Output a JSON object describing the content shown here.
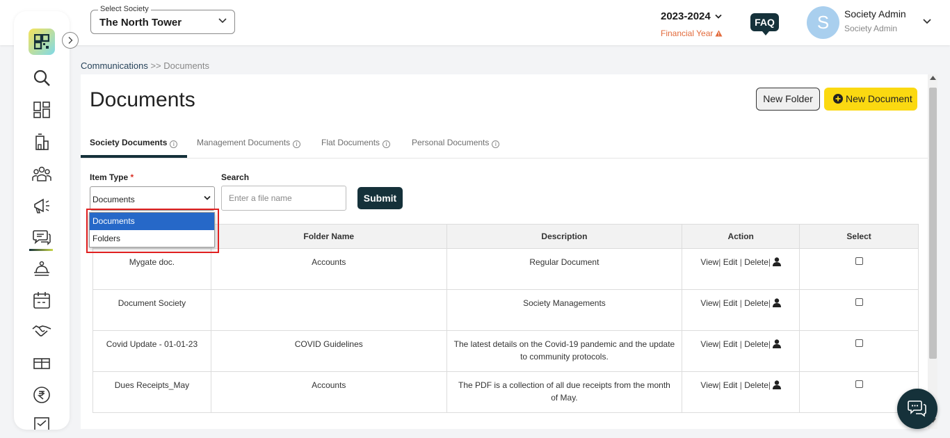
{
  "header": {
    "society_label": "Select Society",
    "society_value": "The North Tower",
    "financial_year": "2023-2024",
    "financial_year_label": "Financial Year",
    "faq_label": "FAQ",
    "avatar_initial": "S",
    "user_name": "Society Admin",
    "user_role": "Society Admin"
  },
  "sidebar": {
    "items": [
      "search-icon",
      "dashboard-icon",
      "building-icon",
      "community-icon",
      "announcement-icon",
      "communications-icon",
      "helpdesk-icon",
      "calendar-icon",
      "handshake-icon",
      "amenities-icon",
      "payments-icon",
      "reports-icon"
    ]
  },
  "breadcrumb": {
    "parent": "Communications",
    "separator": ">>",
    "current": "Documents"
  },
  "page": {
    "title": "Documents",
    "new_folder": "New Folder",
    "new_document": "New Document"
  },
  "tabs": [
    {
      "label": "Society Documents",
      "active": true
    },
    {
      "label": "Management Documents",
      "active": false
    },
    {
      "label": "Flat Documents",
      "active": false
    },
    {
      "label": "Personal Documents",
      "active": false
    }
  ],
  "filters": {
    "item_type_label": "Item Type",
    "required_mark": "*",
    "item_type_value": "Documents",
    "search_label": "Search",
    "search_placeholder": "Enter a file name",
    "submit_label": "Submit"
  },
  "dropdown": {
    "options": [
      {
        "label": "Documents",
        "selected": true
      },
      {
        "label": "Folders",
        "selected": false
      }
    ]
  },
  "table": {
    "columns": [
      "",
      "Folder Name",
      "Description",
      "Action",
      "Select"
    ],
    "action_labels": {
      "view": "View",
      "edit": "Edit",
      "delete": "Delete",
      "sep": "|"
    },
    "rows": [
      {
        "name": "Mygate doc.",
        "folder": "Accounts",
        "description": "Regular Document"
      },
      {
        "name": "Document Society",
        "folder": "",
        "description": "Society Managements"
      },
      {
        "name": "Covid Update - 01-01-23",
        "folder": "COVID Guidelines",
        "description": "The latest details on the Covid-19 pandemic and the update to community protocols."
      },
      {
        "name": "Dues Receipts_May",
        "folder": "Accounts",
        "description": "The PDF is a collection of all due receipts from the month of May."
      }
    ]
  },
  "colors": {
    "primary": "#15313a",
    "accent_yellow": "#fbd911",
    "warning": "#e26a3b",
    "link": "#2563a8",
    "highlight": "#e02020"
  }
}
